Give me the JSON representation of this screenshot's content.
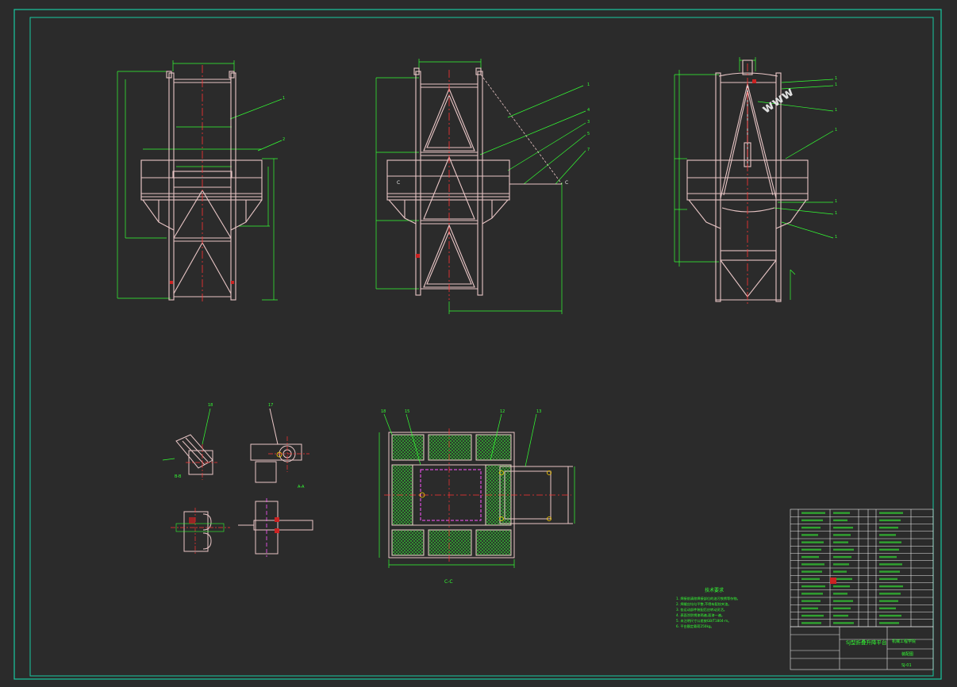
{
  "drawing": {
    "background": "#2b2b2b",
    "border_color": "#19c8a0",
    "frame_color": "#e8e8e8",
    "structure_color": "#e9c6c6",
    "dimension_color": "#33ff33",
    "center_color": "#ff3333",
    "leader_color": "#33ff33",
    "accent_color": "#ff55ff",
    "tag_color": "#cc2222",
    "hatch_color": "#33cc33"
  },
  "views": {
    "front_view_label": "",
    "side_view_label": "",
    "right_view_label": "",
    "section_label": "C-C",
    "detail_a_label": "A",
    "detail_b_label": "B",
    "detail_a_scale_label": "A-A",
    "detail_b_scale_label": "B-B"
  },
  "watermark": "www",
  "title_block": {
    "drawing_title": "SJ型折叠升降平台",
    "company_name": "机械工程学院",
    "drawing_number": "SJ-01",
    "assembly_label": "装配图",
    "scale": "1:10",
    "sheet": "1"
  },
  "notes": {
    "heading": "技术要求",
    "lines": [
      "1. 焊接前清除焊接部位的油污铁锈等杂物。",
      "2. 焊缝应均匀平整,不得有裂纹夹渣。",
      "3. 各运动部件装配后应转动灵活。",
      "4. 表面涂防锈漆两遍,面漆一遍。",
      "5. 未注明尺寸公差按GB/T1804-m。",
      "6. 平台额定载荷250kg。"
    ]
  },
  "parts_list": {
    "rows": 16
  }
}
